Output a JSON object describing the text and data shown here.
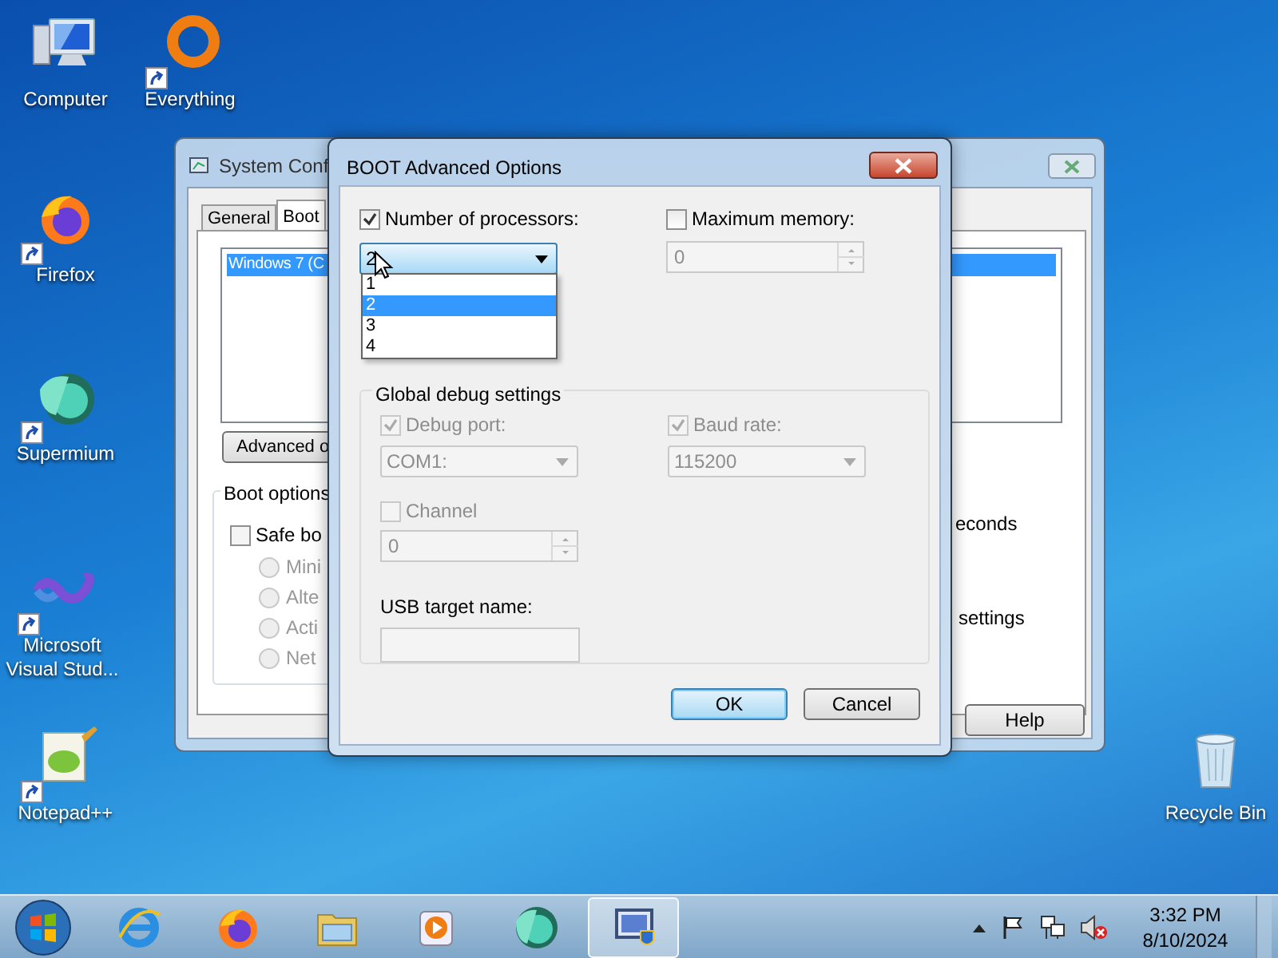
{
  "desktop_icons": [
    {
      "label": "Computer",
      "kind": "computer",
      "shortcut": false
    },
    {
      "label": "Everything",
      "kind": "everything",
      "shortcut": true
    },
    {
      "label": "Firefox",
      "kind": "firefox",
      "shortcut": true
    },
    {
      "label": "Supermium",
      "kind": "supermium",
      "shortcut": true
    },
    {
      "label": "Microsoft Visual Stud...",
      "kind": "vs",
      "shortcut": true
    },
    {
      "label": "Notepad++",
      "kind": "notepad",
      "shortcut": true
    },
    {
      "label": "Recycle Bin",
      "kind": "bin",
      "shortcut": false
    }
  ],
  "system_config": {
    "title": "System Conf",
    "tabs": [
      {
        "label": "General",
        "selected": false
      },
      {
        "label": "Boot",
        "selected": true
      }
    ],
    "os_list": [
      {
        "label": "Windows 7 (C",
        "selected": true
      }
    ],
    "advanced_button": "Advanced o",
    "boot_options": {
      "title": "Boot options",
      "safe_boot": {
        "label": "Safe bo",
        "checked": false
      },
      "modes": [
        {
          "label": "Mini",
          "selected": false
        },
        {
          "label": "Alte",
          "selected": false
        },
        {
          "label": "Acti",
          "selected": false
        },
        {
          "label": "Net",
          "selected": false
        }
      ]
    },
    "timeout_fragment": "econds",
    "settings_fragment": "settings",
    "help_button": "Help"
  },
  "dialog": {
    "title": "BOOT Advanced Options",
    "processors": {
      "label": "Number of processors:",
      "checked": true,
      "value": "2",
      "expanded": true,
      "options": [
        {
          "label": "1",
          "selected": false
        },
        {
          "label": "2",
          "selected": true
        },
        {
          "label": "3",
          "selected": false
        },
        {
          "label": "4",
          "selected": false
        }
      ]
    },
    "memory": {
      "label": "Maximum memory:",
      "checked": false,
      "value": "0"
    },
    "debug": {
      "title": "Global debug settings",
      "debug_port": {
        "label": "Debug port:",
        "checked": true,
        "disabled": true,
        "value": "COM1:"
      },
      "baud_rate": {
        "label": "Baud rate:",
        "checked": true,
        "disabled": true,
        "value": "115200"
      },
      "channel": {
        "label": "Channel",
        "checked": false,
        "disabled": true,
        "value": "0"
      },
      "usb_target": {
        "label": "USB target name:",
        "disabled": true
      }
    },
    "buttons": [
      {
        "label": "OK",
        "kind": "default"
      },
      {
        "label": "Cancel",
        "kind": "normal"
      }
    ]
  },
  "taskbar": {
    "apps": [
      {
        "kind": "ie",
        "selected": false
      },
      {
        "kind": "firefox",
        "selected": false
      },
      {
        "kind": "explorer",
        "selected": false
      },
      {
        "kind": "media",
        "selected": false
      },
      {
        "kind": "supermium",
        "selected": false
      },
      {
        "kind": "msconfig",
        "selected": true
      }
    ],
    "time": "3:32 PM",
    "date": "8/10/2024"
  }
}
